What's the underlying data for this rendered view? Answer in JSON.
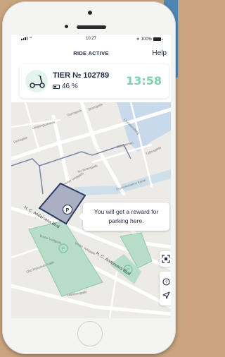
{
  "status_bar": {
    "time": "10:27",
    "battery": "100%"
  },
  "header": {
    "title": "RIDE ACTIVE",
    "help": "Help"
  },
  "vehicle": {
    "id": "TIER № 102789",
    "battery_pct": "46 %",
    "battery_level": 0.46,
    "timer": "13:58"
  },
  "map": {
    "tooltip": "You will get a reward for parking here.",
    "streets": [
      "Ferrogade",
      "Langangsstræde",
      "Stormgade",
      "Stormgade",
      "Christiansborg",
      "Slotsholmen",
      "Ny Vestergade",
      "Frederiksholms Kanal",
      "Tøjhusgade",
      "Vester Voldgade",
      "Vester Voldgade",
      "H. C. Andersens Blvd",
      "H. C. Andersens Blvd",
      "Vester Voldgade",
      "Otto Mønsteds Gade",
      "Hambrosgade"
    ]
  },
  "colors": {
    "accent": "#7fd1a9",
    "navy": "#1f2a44",
    "park_zone": "#b8ddc8"
  }
}
